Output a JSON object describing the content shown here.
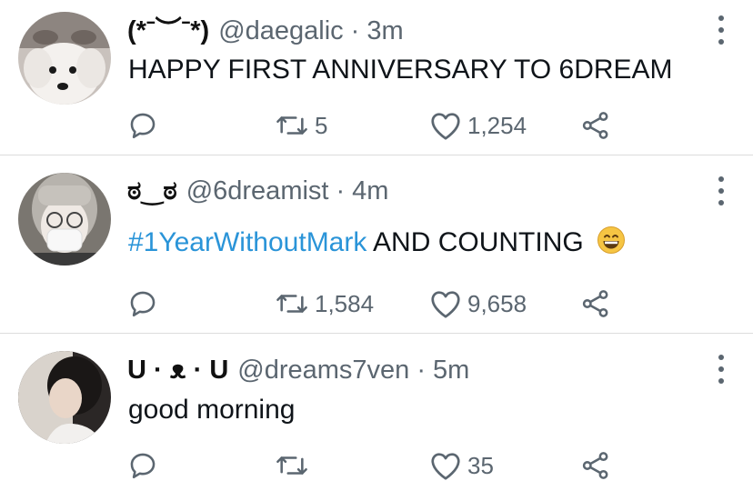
{
  "tweets": [
    {
      "name": "(*ˉ︶ˉ*)",
      "handle": "@daegalic",
      "sep": "·",
      "time": "3m",
      "text": "HAPPY FIRST ANNIVERSARY TO 6DREAM",
      "retweets": "5",
      "likes": "1,254"
    },
    {
      "name": "ಠ‿ಠ",
      "handle": "@6dreamist",
      "sep": "·",
      "time": "4m",
      "hashtag": "#1YearWithoutMark",
      "text": "AND COUNTING",
      "emoji": "grinning-face",
      "retweets": "1,584",
      "likes": "9,658"
    },
    {
      "name": "U · ᴥ · U",
      "handle": "@dreams7ven",
      "sep": "·",
      "time": "5m",
      "text": "good morning",
      "retweets": "",
      "likes": "35"
    }
  ],
  "icons": {
    "reply": "reply-icon",
    "retweet": "retweet-icon",
    "like": "heart-icon",
    "share": "share-icon",
    "more": "more-vertical-icon"
  },
  "colors": {
    "text": "#0f1419",
    "muted": "#5b6670",
    "link": "#2a94d8",
    "divider": "#dcdcdc"
  }
}
